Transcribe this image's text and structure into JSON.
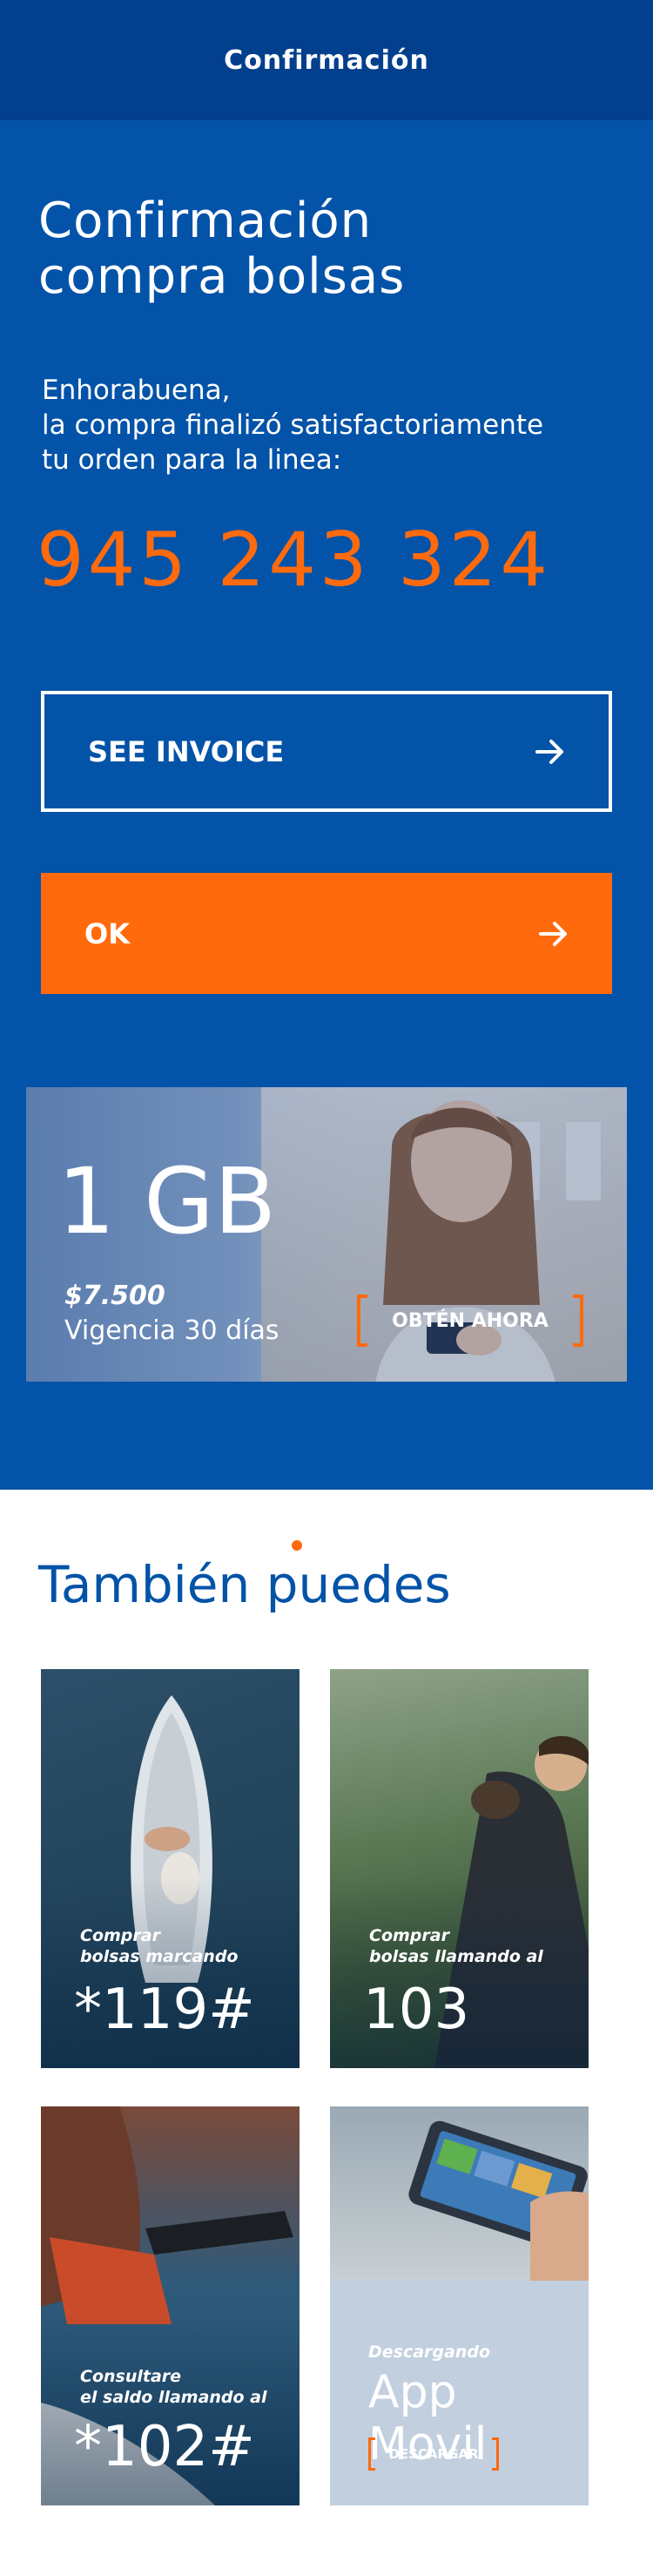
{
  "header": {
    "title": "Confirmación"
  },
  "hero": {
    "title_line1": "Confirmación",
    "title_line2": "compra bolsas",
    "msg_line1": "Enhorabuena,",
    "msg_line2": "la compra finalizó satisfactoriamente",
    "msg_line3": "tu orden para la linea:",
    "phone_number": "945 243 324",
    "see_invoice_label": "SEE INVOICE",
    "ok_label": "OK"
  },
  "promo": {
    "amount": "1 GB",
    "price": "$7.500",
    "validity": "Vigencia 30 días",
    "cta_label": "OBTÉN AHORA",
    "slides_total": 3,
    "slide_active": 1
  },
  "also": {
    "title": "También puedes",
    "cards": [
      {
        "label_line1": "Comprar",
        "label_line2": "bolsas marcando",
        "value": "*119#"
      },
      {
        "label_line1": "Comprar",
        "label_line2": "bolsas llamando al",
        "value": "103"
      },
      {
        "label_line1": "Consultare",
        "label_line2": "el saldo llamando al",
        "value": "*102#"
      },
      {
        "label_line1": "Descargando",
        "value": "App Movil",
        "cta_label": "DESCARGAR"
      }
    ]
  },
  "colors": {
    "header_bg": "#023f8c",
    "hero_bg": "#0353a8",
    "accent_orange": "#ff6a0d",
    "text_white": "#ffffff"
  },
  "icons": [
    "arrow-right-icon"
  ]
}
